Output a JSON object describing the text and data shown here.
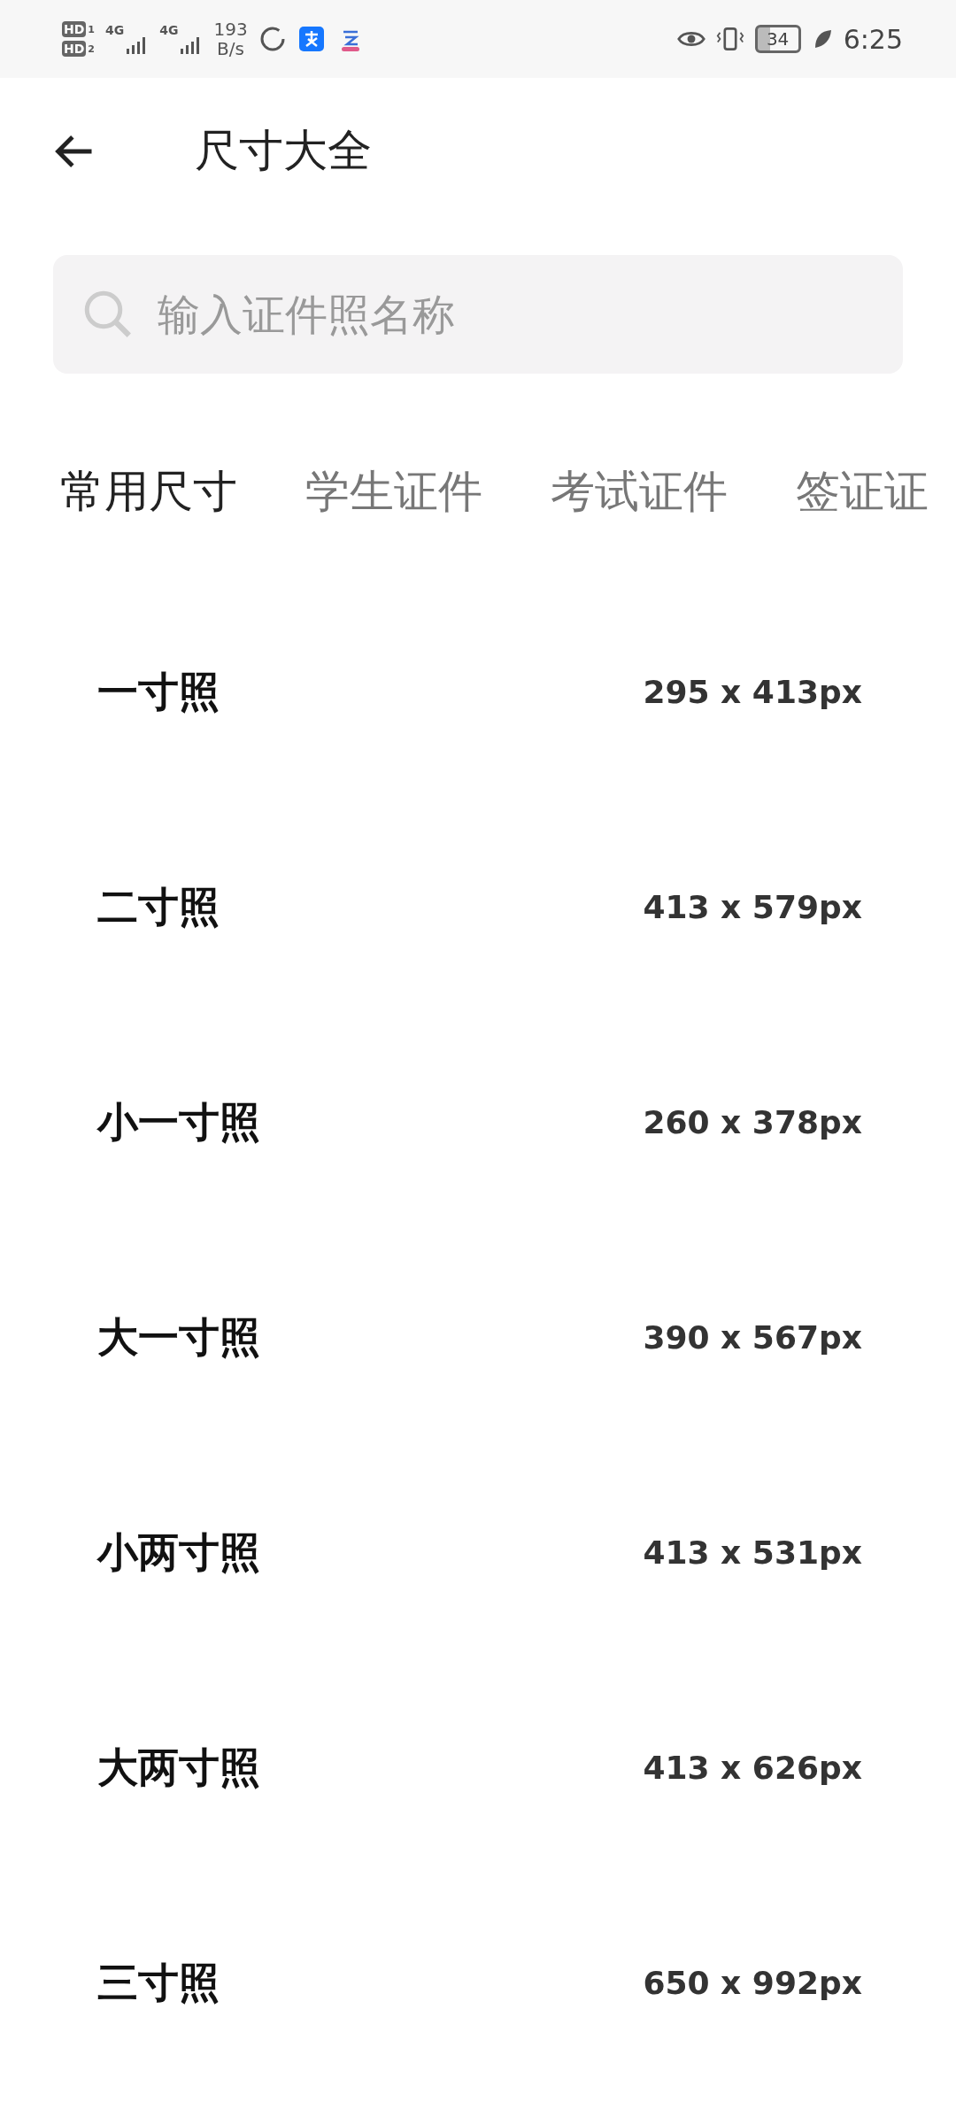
{
  "status_bar": {
    "sims": [
      {
        "badge": "HD",
        "slot": "1"
      },
      {
        "badge": "HD",
        "slot": "2"
      }
    ],
    "networks": [
      "4G",
      "4G"
    ],
    "speed": [
      "193",
      "B/s"
    ],
    "battery": "34",
    "time": "6:25"
  },
  "header": {
    "title": "尺寸大全"
  },
  "search": {
    "placeholder": "输入证件照名称"
  },
  "tabs": [
    {
      "label": "常用尺寸",
      "selected": true
    },
    {
      "label": "学生证件",
      "selected": false
    },
    {
      "label": "考试证件",
      "selected": false
    },
    {
      "label": "签证证",
      "selected": false
    }
  ],
  "sizes": [
    {
      "name": "一寸照",
      "size": "295 x 413px"
    },
    {
      "name": "二寸照",
      "size": "413 x 579px"
    },
    {
      "name": "小一寸照",
      "size": "260 x 378px"
    },
    {
      "name": "大一寸照",
      "size": "390 x 567px"
    },
    {
      "name": "小两寸照",
      "size": "413 x 531px"
    },
    {
      "name": "大两寸照",
      "size": "413 x 626px"
    },
    {
      "name": "三寸照",
      "size": "650 x 992px"
    }
  ]
}
